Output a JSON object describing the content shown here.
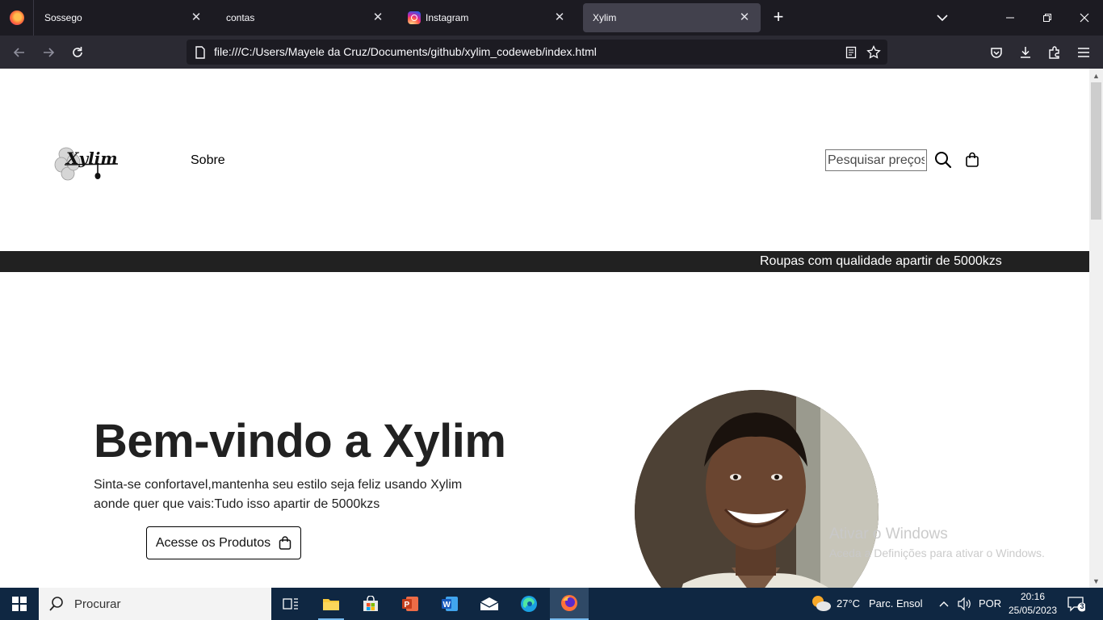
{
  "browser": {
    "tabs": [
      {
        "label": "Sossego",
        "active": false
      },
      {
        "label": "contas",
        "active": false
      },
      {
        "label": "Instagram",
        "active": false
      },
      {
        "label": "Xylim",
        "active": true
      }
    ],
    "url": "file:///C:/Users/Mayele da Cruz/Documents/github/xylim_codeweb/index.html"
  },
  "site": {
    "logo_text": "Xylim",
    "nav_sobre": "Sobre",
    "search_placeholder": "Pesquisar preços.",
    "promo": "Roupas com qualidade apartir de 5000kzs",
    "hero_title": "Bem-vindo a Xylim",
    "hero_text": "Sinta-se confortavel,mantenha seu estilo seja feliz usando Xylim aonde quer que vais:Tudo isso apartir de 5000kzs",
    "cta_label": "Acesse os Produtos"
  },
  "watermark": {
    "title": "Ativar o Windows",
    "subtitle": "Aceda a Definições para ativar o Windows."
  },
  "taskbar": {
    "search_placeholder": "Procurar",
    "weather_temp": "27°C",
    "weather_desc": "Parc. Ensol",
    "language": "POR",
    "time": "20:16",
    "date": "25/05/2023",
    "notifications": "3"
  },
  "colors": {
    "tabbar": "#1c1b22",
    "toolbar": "#2b2a33",
    "promo_bar": "#212121",
    "taskbar": "#0f2742"
  }
}
